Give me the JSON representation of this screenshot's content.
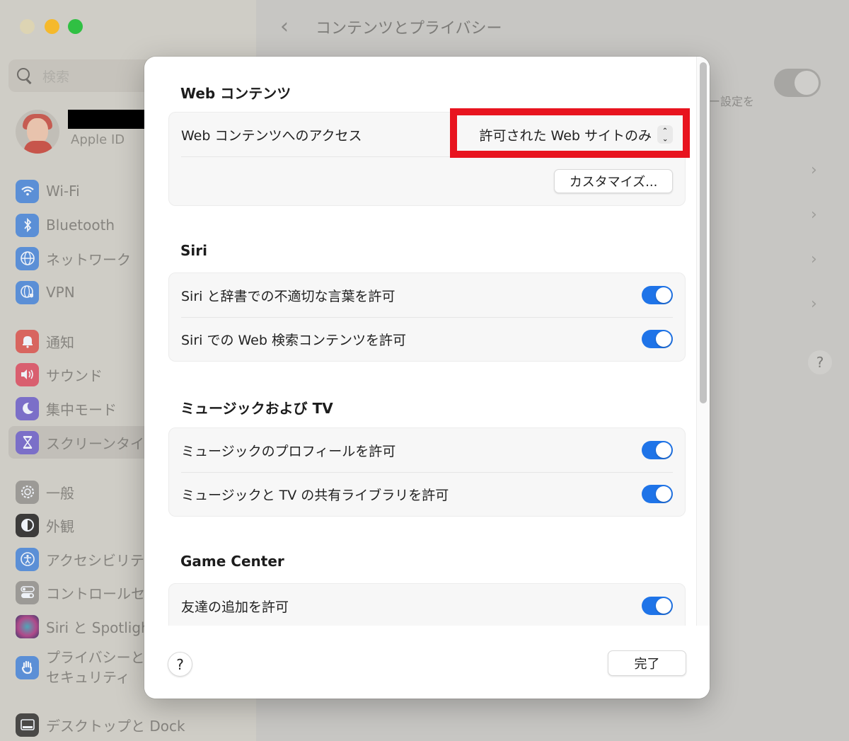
{
  "window": {
    "traffic_lights": [
      "close",
      "minimize",
      "maximize"
    ]
  },
  "sidebar": {
    "search_placeholder": "検索",
    "apple_id_label": "Apple ID",
    "items": [
      {
        "label": "Wi-Fi",
        "icon": "wifi-icon",
        "color": "#5b8fd6"
      },
      {
        "label": "Bluetooth",
        "icon": "bluetooth-icon",
        "color": "#5b8fd6"
      },
      {
        "label": "ネットワーク",
        "icon": "globe-icon",
        "color": "#5b8fd6"
      },
      {
        "label": "VPN",
        "icon": "vpn-globe-icon",
        "color": "#5b8fd6"
      },
      {
        "label": "通知",
        "icon": "bell-icon",
        "color": "#d8655f"
      },
      {
        "label": "サウンド",
        "icon": "speaker-icon",
        "color": "#d95f6f"
      },
      {
        "label": "集中モード",
        "icon": "moon-icon",
        "color": "#7b6fc8"
      },
      {
        "label": "スクリーンタイム",
        "icon": "hourglass-icon",
        "color": "#7b6fc8",
        "selected": true
      },
      {
        "label": "一般",
        "icon": "gear-icon",
        "color": "#9c9a96"
      },
      {
        "label": "外観",
        "icon": "appearance-icon",
        "color": "#3c3b3a"
      },
      {
        "label": "アクセシビリティ",
        "icon": "accessibility-icon",
        "color": "#5b8fd6"
      },
      {
        "label": "コントロールセンター",
        "icon": "control-center-icon",
        "color": "#9c9a96"
      },
      {
        "label": "Siri と Spotlight",
        "icon": "siri-icon",
        "color": "#7a5a9a"
      },
      {
        "label": "プライバシーと\nセキュリティ",
        "icon": "hand-icon",
        "color": "#5b8fd6"
      },
      {
        "label": "デスクトップと Dock",
        "icon": "dock-icon",
        "color": "#4a4947"
      }
    ]
  },
  "header": {
    "back_label": "‹",
    "title": "コンテンツとプライバシー"
  },
  "background_pane": {
    "text_fragment": "ー設定を",
    "help_label": "?"
  },
  "sheet": {
    "sections": [
      {
        "title": "Web コンテンツ",
        "rows": [
          {
            "label": "Web コンテンツへのアクセス",
            "type": "popup",
            "value": "許可された Web サイトのみ",
            "highlighted": true
          }
        ],
        "button": "カスタマイズ..."
      },
      {
        "title": "Siri",
        "rows": [
          {
            "label": "Siri と辞書での不適切な言葉を許可",
            "type": "toggle",
            "on": true
          },
          {
            "label": "Siri での Web 検索コンテンツを許可",
            "type": "toggle",
            "on": true
          }
        ]
      },
      {
        "title": "ミュージックおよび TV",
        "rows": [
          {
            "label": "ミュージックのプロフィールを許可",
            "type": "toggle",
            "on": true
          },
          {
            "label": "ミュージックと TV の共有ライブラリを許可",
            "type": "toggle",
            "on": true
          }
        ]
      },
      {
        "title": "Game Center",
        "rows": [
          {
            "label": "友達の追加を許可",
            "type": "toggle",
            "on": true
          }
        ]
      }
    ],
    "footer": {
      "help_label": "?",
      "done_label": "完了"
    },
    "accent_color": "#1f74e8",
    "highlight_color": "#e8141f"
  }
}
